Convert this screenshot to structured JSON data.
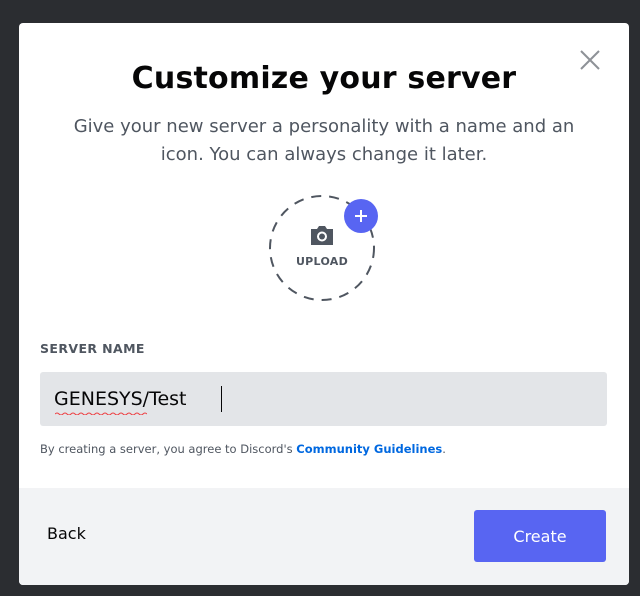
{
  "modal": {
    "title": "Customize your server",
    "subtitle": "Give your new server a personality with a name and an icon. You can always change it later.",
    "close_icon": "close-icon"
  },
  "upload": {
    "label": "UPLOAD",
    "icon": "camera-icon",
    "badge_icon": "plus-icon",
    "accent": "#5865f2"
  },
  "server_name": {
    "label": "SERVER NAME",
    "value": "GENESYS/Test"
  },
  "terms": {
    "prefix": "By creating a server, you agree to Discord's ",
    "link": "Community Guidelines",
    "suffix": "."
  },
  "footer": {
    "back_label": "Back",
    "create_label": "Create"
  },
  "colors": {
    "brand": "#5865f2",
    "link": "#0068e0",
    "input_bg": "#e3e5e8",
    "footer_bg": "#f2f3f5"
  }
}
